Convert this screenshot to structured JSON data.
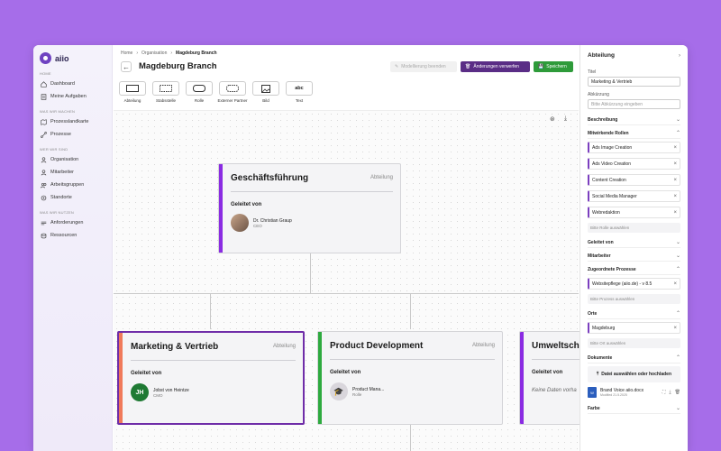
{
  "app": {
    "name": "aiio"
  },
  "sidebar": {
    "sections": [
      {
        "label": "HOME",
        "items": [
          {
            "label": "Dashboard",
            "icon": "home-icon"
          },
          {
            "label": "Meine Aufgaben",
            "icon": "tasks-icon"
          }
        ]
      },
      {
        "label": "WAS WIR MACHEN",
        "items": [
          {
            "label": "Prozesslandkarte",
            "icon": "map-icon"
          },
          {
            "label": "Prozesse",
            "icon": "process-icon"
          }
        ]
      },
      {
        "label": "WER WIR SIND",
        "items": [
          {
            "label": "Organisation",
            "icon": "org-icon"
          },
          {
            "label": "Mitarbeiter",
            "icon": "user-icon"
          },
          {
            "label": "Arbeitsgruppen",
            "icon": "group-icon"
          },
          {
            "label": "Standorte",
            "icon": "location-icon"
          }
        ]
      },
      {
        "label": "WAS WIR NUTZEN",
        "items": [
          {
            "label": "Anforderungen",
            "icon": "requirements-icon"
          },
          {
            "label": "Ressourcen",
            "icon": "resources-icon"
          }
        ]
      }
    ]
  },
  "breadcrumb": {
    "items": [
      "Home",
      "Organisation",
      "Magdeburg Branch"
    ]
  },
  "header": {
    "title": "Magdeburg Branch",
    "btn_modification": "Modellierung beenden",
    "btn_discard": "Änderungen verwerfen",
    "btn_save": "Speichern"
  },
  "toolbar": {
    "tools": [
      {
        "label": "Abteilung"
      },
      {
        "label": "Stabsstelle"
      },
      {
        "label": "Rolle"
      },
      {
        "label": "Externer Partner"
      },
      {
        "label": "Bild"
      },
      {
        "label": "Text",
        "glyph": "abc"
      }
    ]
  },
  "cards": {
    "top": {
      "title": "Geschäftsführung",
      "type": "Abteilung",
      "led_by": "Geleitet von",
      "person_name": "Dr. Christian Graup",
      "person_role": "CEO",
      "stripe": "#8a2be2"
    },
    "marketing": {
      "title": "Marketing & Vertrieb",
      "type": "Abteilung",
      "led_by": "Geleitet von",
      "person_name": "Jobst von Heintze",
      "person_role": "CMO",
      "initials": "JH",
      "stripe": "#f07a5a",
      "border": "#6f2da8"
    },
    "product": {
      "title": "Product Development",
      "type": "Abteilung",
      "led_by": "Geleitet von",
      "person_name": "Product Mana...",
      "person_role": "Rolle",
      "stripe": "#2eaa3f"
    },
    "umwelt": {
      "title": "Umweltschu",
      "led_by": "Geleitet von",
      "empty_text": "Keine Daten vorha",
      "stripe": "#8a2be2"
    }
  },
  "panel": {
    "heading": "Abteilung",
    "title_label": "Titel",
    "title_value": "Marketing & Vertrieb",
    "abbr_label": "Abkürzung",
    "abbr_placeholder": "Bitte Abkürzung eingeben",
    "beschreibung": "Beschreibung",
    "roles_heading": "Mitwirkende Rollen",
    "roles": [
      "Ads Image Creation",
      "Ads Video Creation",
      "Content Creation",
      "Social Media Manager",
      "Webredaktion"
    ],
    "roles_placeholder": "Bitte Rolle auswählen",
    "geleitet_von": "Geleitet von",
    "mitarbeiter": "Mitarbeiter",
    "processes_heading": "Zugeordnete Prozesse",
    "processes": [
      "Websitepflege (aiio.de) - v 8.5"
    ],
    "processes_placeholder": "Bitte Prozess auswählen",
    "orte_heading": "Orte",
    "orte": [
      "Magdeburg"
    ],
    "orte_placeholder": "Bitte Ort auswählen",
    "dokumente_heading": "Dokumente",
    "upload_label": "Datei auswählen oder hochladen",
    "file_name": "Brand Voice aiio.docx",
    "file_meta": "Modified 21.5.2025",
    "farbe": "Farbe"
  }
}
